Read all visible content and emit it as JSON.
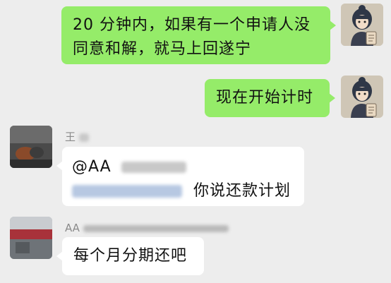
{
  "messages": [
    {
      "side": "out",
      "text_line1": "20 分钟内，如果有一个申请人没",
      "text_line2": "同意和解，就马上回遂宁"
    },
    {
      "side": "out",
      "text": "现在开始计时"
    },
    {
      "side": "in",
      "sender": "王",
      "mention": "@AA",
      "text": "你说还款计划"
    },
    {
      "side": "in",
      "sender": "AA",
      "text": "每个月分期还吧"
    }
  ],
  "colors": {
    "background": "#ededed",
    "outgoing_bubble": "#95ec69",
    "incoming_bubble": "#ffffff",
    "name_text": "#8a8a8a"
  }
}
